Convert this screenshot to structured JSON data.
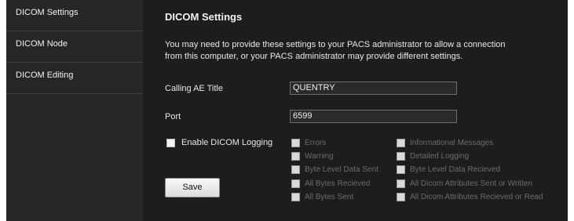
{
  "sidebar": {
    "items": [
      {
        "label": "DICOM Settings"
      },
      {
        "label": "DICOM Node"
      },
      {
        "label": "DICOM Editing"
      }
    ]
  },
  "main": {
    "title": "DICOM Settings",
    "description_line1": "You may need to provide these settings to your PACS administrator to allow a connection",
    "description_line2": "from this computer, or your PACS administrator may provide different settings.",
    "calling_ae_title": {
      "label": "Calling AE Title",
      "value": "QUENTRY"
    },
    "port": {
      "label": "Port",
      "value": "6599"
    },
    "enable_logging_label": "Enable DICOM Logging",
    "logging_options_left": [
      "Errors",
      "Warning",
      "Byte Level Data Sent",
      "All Bytes Recieved",
      "All Bytes Sent"
    ],
    "logging_options_right": [
      "Informational Messages",
      "Detailed Logging",
      "Byte Level Data Recieved",
      "All Dicom Attributes Sent or Written",
      "All Dicom Attributes Recieved or Read"
    ],
    "save_label": "Save"
  }
}
